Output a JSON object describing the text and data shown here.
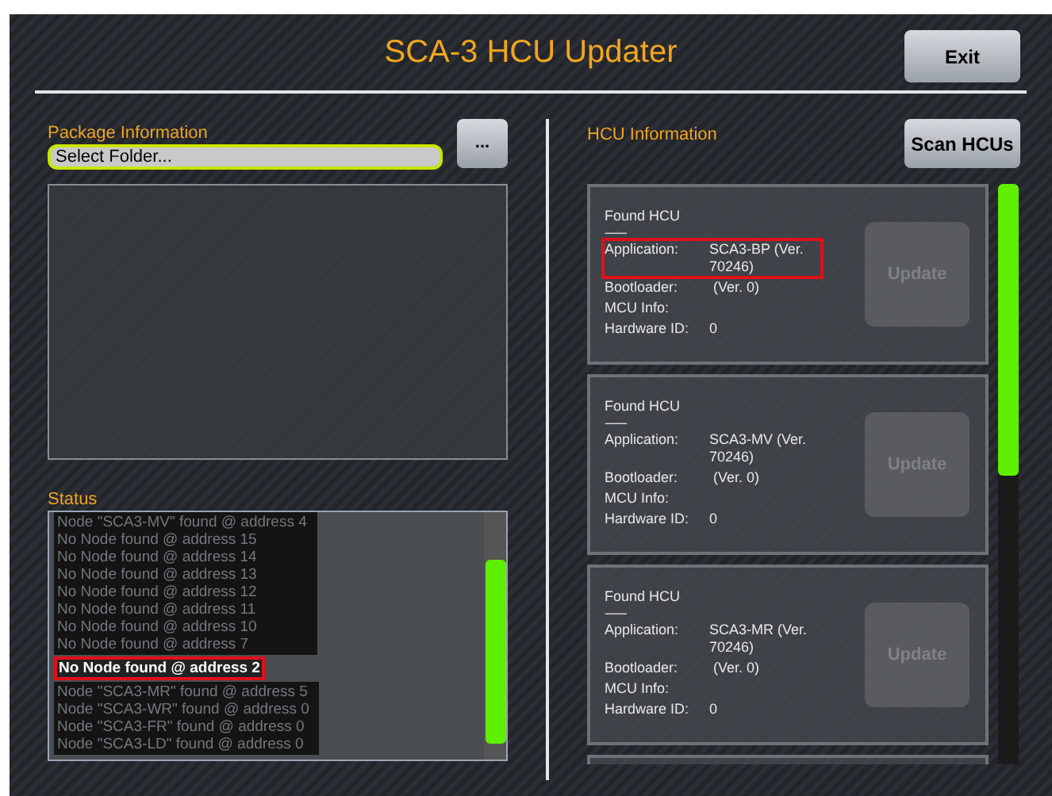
{
  "title": "SCA-3 HCU Updater",
  "exit_button": "Exit",
  "package": {
    "heading": "Package Information",
    "folder_field": {
      "placeholder": "Select Folder..."
    },
    "browse_button": "..."
  },
  "status": {
    "heading": "Status",
    "lines": [
      {
        "text": "Node \"SCA3-MV\" found @ address 4",
        "highlighted": false
      },
      {
        "text": "No Node found @ address 15",
        "highlighted": false
      },
      {
        "text": "No Node found @ address 14",
        "highlighted": false
      },
      {
        "text": "No Node found @ address 13",
        "highlighted": false
      },
      {
        "text": "No Node found @ address 12",
        "highlighted": false
      },
      {
        "text": "No Node found @ address 11",
        "highlighted": false
      },
      {
        "text": "No Node found @ address 10",
        "highlighted": false
      },
      {
        "text": "No Node found @ address 7",
        "highlighted": false
      },
      {
        "text": "No Node found @ address 2",
        "highlighted": true
      },
      {
        "text": "Node \"SCA3-MR\" found @ address 5",
        "highlighted": false
      },
      {
        "text": "Node \"SCA3-WR\" found @ address 0",
        "highlighted": false
      },
      {
        "text": "Node \"SCA3-FR\" found @ address 0",
        "highlighted": false
      },
      {
        "text": "Node \"SCA3-LD\" found @ address 0",
        "highlighted": false
      }
    ]
  },
  "hcu": {
    "heading": "HCU Information",
    "scan_button": "Scan HCUs",
    "cards": [
      {
        "title": "Found HCU",
        "separator": "----------",
        "fields": [
          {
            "label": "Application:",
            "value": "SCA3-BP (Ver. 70246)",
            "highlighted": true
          },
          {
            "label": "Bootloader:",
            "value": " (Ver. 0)",
            "highlighted": false
          },
          {
            "label": "MCU Info:",
            "highlighted": false
          },
          {
            "label": "Hardware ID:",
            "value": "0",
            "highlighted": false
          }
        ],
        "update_button": {
          "label": "Update",
          "disabled": true
        }
      },
      {
        "title": "Found HCU",
        "separator": "----------",
        "fields": [
          {
            "label": "Application:",
            "value": "SCA3-MV (Ver. 70246)",
            "highlighted": false
          },
          {
            "label": "Bootloader:",
            "value": " (Ver. 0)",
            "highlighted": false
          },
          {
            "label": "MCU Info:",
            "highlighted": false
          },
          {
            "label": "Hardware ID:",
            "value": "0",
            "highlighted": false
          }
        ],
        "update_button": {
          "label": "Update",
          "disabled": true
        }
      },
      {
        "title": "Found HCU",
        "separator": "----------",
        "fields": [
          {
            "label": "Application:",
            "value": "SCA3-MR (Ver. 70246)",
            "highlighted": false
          },
          {
            "label": "Bootloader:",
            "value": " (Ver. 0)",
            "highlighted": false
          },
          {
            "label": "MCU Info:",
            "highlighted": false
          },
          {
            "label": "Hardware ID:",
            "value": "0",
            "highlighted": false
          }
        ],
        "update_button": {
          "label": "Update",
          "disabled": true
        }
      }
    ]
  }
}
